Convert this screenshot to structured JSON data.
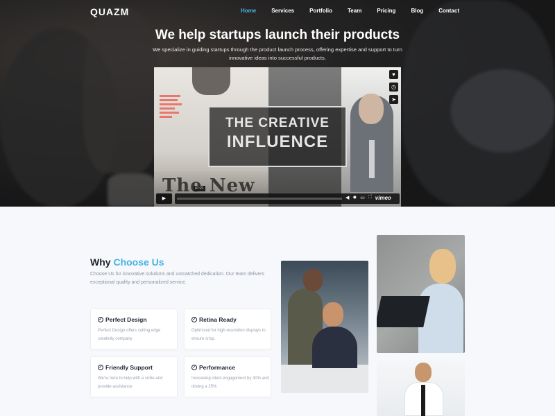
{
  "brand": {
    "logo": "QUAZM",
    "accent": "#47b2e4"
  },
  "nav": {
    "items": [
      {
        "label": "Home",
        "active": true
      },
      {
        "label": "Services",
        "active": false
      },
      {
        "label": "Portfolio",
        "active": false
      },
      {
        "label": "Team",
        "active": false
      },
      {
        "label": "Pricing",
        "active": false
      },
      {
        "label": "Blog",
        "active": false
      },
      {
        "label": "Contact",
        "active": false
      }
    ]
  },
  "hero": {
    "title": "We help startups launch their products",
    "subtitle": "We specialize in guiding startups through the product launch process, offering expertise and support to turn innovative ideas into successful products."
  },
  "video": {
    "headline_line1": "THE CREATIVE",
    "headline_line2": "INFLUENCE",
    "newspaper_text": "The New",
    "timestamp": "07:21",
    "provider": "vimeo",
    "side_icons": [
      "heart-icon",
      "clock-icon",
      "send-icon"
    ],
    "controls": [
      "play-icon",
      "volume-icon",
      "settings-icon",
      "pip-icon",
      "fullscreen-icon"
    ]
  },
  "why": {
    "title_prefix": "Why",
    "title_highlight": "Choose Us",
    "description": "Choose Us for innovative solutions and unmatched dedication. Our team delivers exceptional quality and personalized service.",
    "features": [
      {
        "title": "Perfect Design",
        "desc": "Perfect Design offers cutting edge creativity company"
      },
      {
        "title": "Retina Ready",
        "desc": "Optimized for high-resolution displays to ensure crisp."
      },
      {
        "title": "Friendly Support",
        "desc": "We're here to help with a smile and provide assistance"
      },
      {
        "title": "Performance",
        "desc": "Increasing client engagement by 30% and driving a 25%"
      }
    ]
  }
}
